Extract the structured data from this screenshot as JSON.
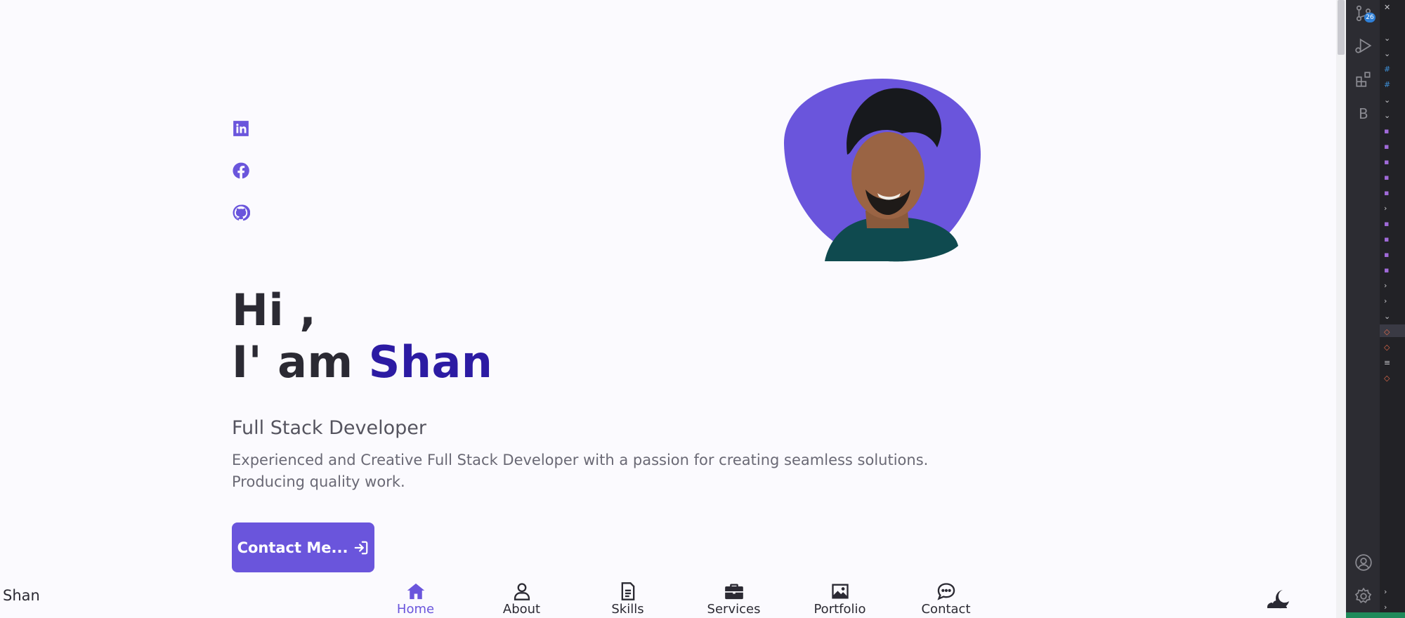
{
  "hero": {
    "greeting_line1": "Hi ,",
    "greeting_line2_prefix": "I' am",
    "name": "Shan",
    "subtitle": "Full Stack Developer",
    "description": "Experienced and Creative Full Stack Developer with a passion for creating seamless solutions. Producing quality work.",
    "contact_label": "Contact Me..."
  },
  "social": {
    "icons": [
      "linkedin-icon",
      "facebook-icon",
      "github-icon"
    ]
  },
  "nav": {
    "logo": "Shan",
    "items": [
      {
        "label": "Home",
        "icon": "home-icon",
        "active": true
      },
      {
        "label": "About",
        "icon": "user-icon",
        "active": false
      },
      {
        "label": "Skills",
        "icon": "file-icon",
        "active": false
      },
      {
        "label": "Services",
        "icon": "briefcase-icon",
        "active": false
      },
      {
        "label": "Portfolio",
        "icon": "image-icon",
        "active": false
      },
      {
        "label": "Contact",
        "icon": "message-icon",
        "active": false
      }
    ],
    "theme_icon": "moon-cloud-icon"
  },
  "editor": {
    "badge_count": "26",
    "bookmark_letter": "B"
  },
  "colors": {
    "accent": "#6a55dc",
    "name_color": "#2c1ba3",
    "background": "#fbfafe",
    "text": "#2b2a33"
  }
}
